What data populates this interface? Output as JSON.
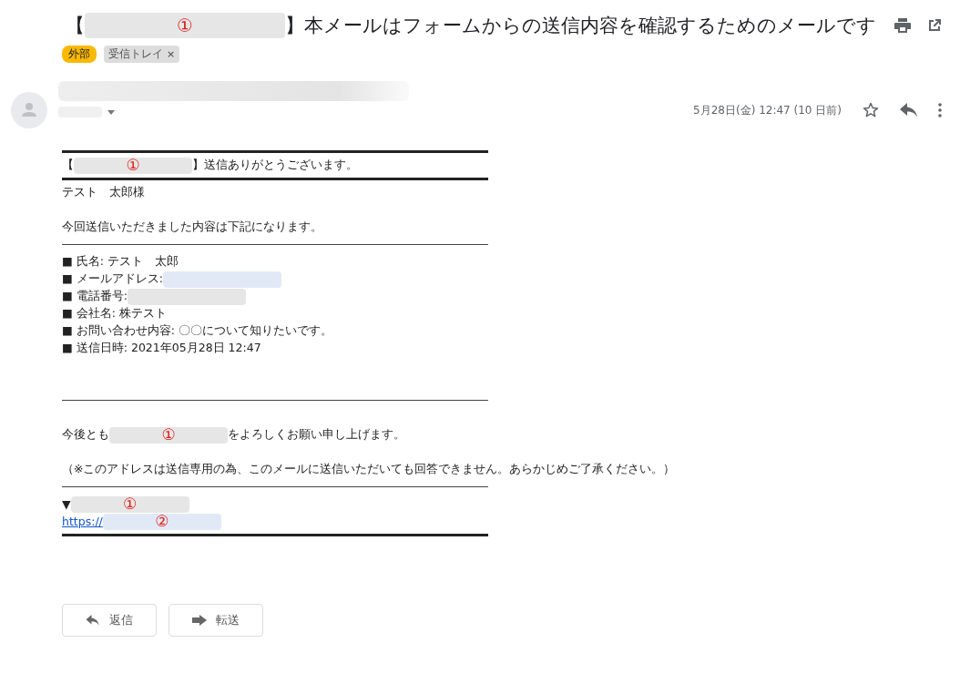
{
  "subject": {
    "parts": [
      {
        "kind": "text",
        "text": "【"
      },
      {
        "kind": "redaction",
        "color": "#e6e6e6",
        "mark": "①"
      },
      {
        "kind": "text",
        "text": "】本メールはフォームからの送信内容を確認するためのメールです"
      }
    ]
  },
  "labels": [
    {
      "kind": "external",
      "text": "外部"
    },
    {
      "kind": "folder",
      "text": "受信トレイ",
      "close": "×"
    }
  ],
  "message": {
    "date": "5月28日(金) 12:47 (10 日前)",
    "body": [
      {
        "kind": "thick-rule"
      },
      {
        "kind": "line",
        "parts": [
          {
            "kind": "text",
            "text": "【"
          },
          {
            "kind": "redaction",
            "color": "#e6e6e6",
            "mark": "①"
          },
          {
            "kind": "text",
            "text": "】送信ありがとうございます。"
          }
        ]
      },
      {
        "kind": "thick-rule"
      },
      {
        "kind": "line",
        "parts": [
          {
            "kind": "text",
            "text": "テスト　太郎様"
          }
        ]
      },
      {
        "kind": "blank"
      },
      {
        "kind": "line",
        "parts": [
          {
            "kind": "text",
            "text": "今回送信いただきました内容は下記になります。"
          }
        ]
      },
      {
        "kind": "thin-rule"
      },
      {
        "kind": "line",
        "parts": [
          {
            "kind": "text",
            "text": "■ 氏名: テスト　太郎"
          }
        ]
      },
      {
        "kind": "line",
        "parts": [
          {
            "kind": "text",
            "text": "■ メールアドレス:"
          },
          {
            "kind": "redaction",
            "color": "#e2e9f6"
          }
        ]
      },
      {
        "kind": "line",
        "parts": [
          {
            "kind": "text",
            "text": "■ 電話番号:"
          },
          {
            "kind": "redaction",
            "color": "#e6e6e6"
          }
        ]
      },
      {
        "kind": "line",
        "parts": [
          {
            "kind": "text",
            "text": "■ 会社名: 株テスト"
          }
        ]
      },
      {
        "kind": "line",
        "parts": [
          {
            "kind": "text",
            "text": "■ お問い合わせ内容: 〇〇について知りたいです。"
          }
        ]
      },
      {
        "kind": "line",
        "parts": [
          {
            "kind": "text",
            "text": "■ 送信日時: 2021年05月28日 12:47"
          }
        ]
      },
      {
        "kind": "blank"
      },
      {
        "kind": "blank"
      },
      {
        "kind": "thin-rule"
      },
      {
        "kind": "blank"
      },
      {
        "kind": "line",
        "parts": [
          {
            "kind": "text",
            "text": "今後とも"
          },
          {
            "kind": "redaction",
            "color": "#e6e6e6",
            "mark": "①"
          },
          {
            "kind": "text",
            "text": "をよろしくお願い申し上げます。"
          }
        ]
      },
      {
        "kind": "blank"
      },
      {
        "kind": "line",
        "parts": [
          {
            "kind": "text",
            "text": "（※このアドレスは送信専用の為、このメールに送信いただいても回答できません。あらかじめご了承ください。）"
          }
        ]
      },
      {
        "kind": "thin-rule"
      },
      {
        "kind": "line",
        "parts": [
          {
            "kind": "text",
            "text": "▼"
          },
          {
            "kind": "redaction",
            "color": "#e6e6e6",
            "mark": "①"
          }
        ]
      },
      {
        "kind": "line",
        "parts": [
          {
            "kind": "link",
            "text": "https://"
          },
          {
            "kind": "redaction",
            "color": "#e2e9f6",
            "mark": "②"
          }
        ]
      },
      {
        "kind": "thick-rule"
      }
    ]
  },
  "actions": [
    {
      "kind": "reply",
      "label": "返信"
    },
    {
      "kind": "forward",
      "label": "転送"
    }
  ]
}
